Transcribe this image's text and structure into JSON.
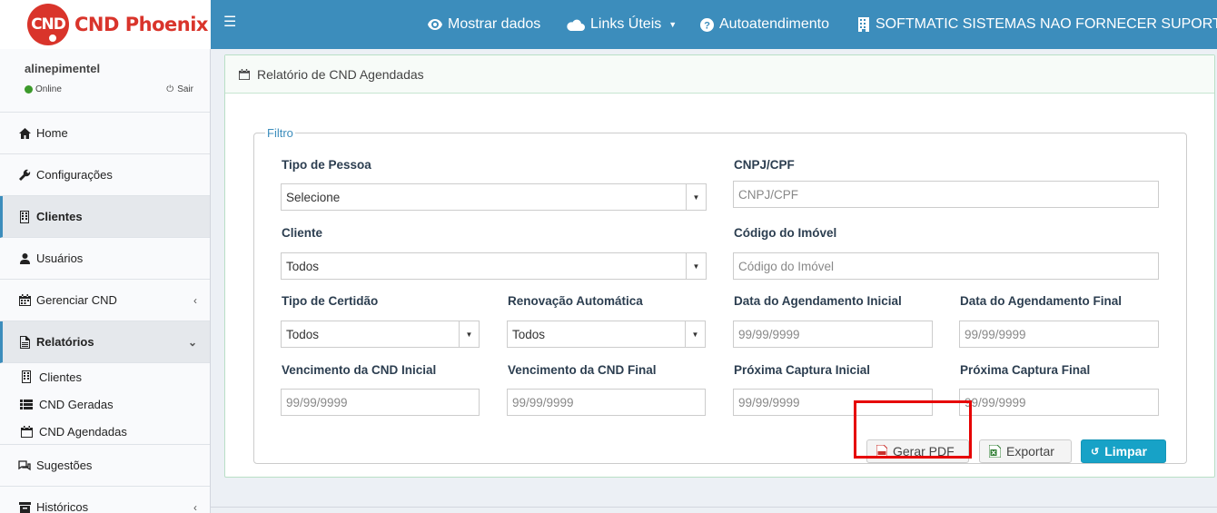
{
  "brand": {
    "badge": "CND",
    "name": "CND Phoenix",
    "color": "#d9342b"
  },
  "navbar": {
    "menu_icon": "hamburger-icon",
    "mostrar_dados": "Mostrar dados",
    "links_uteis": "Links Úteis",
    "autoatendimento": "Autoatendimento",
    "company": "SOFTMATIC SISTEMAS NAO FORNECER SUPORTE",
    "color": "#3c8dbc"
  },
  "user": {
    "name": "alinepimentel",
    "status": "Online",
    "logout": "Sair"
  },
  "sidebar": {
    "items": [
      {
        "label": "Home",
        "icon": "home-icon"
      },
      {
        "label": "Configurações",
        "icon": "wrench-icon"
      },
      {
        "label": "Clientes",
        "icon": "building-icon"
      },
      {
        "label": "Usuários",
        "icon": "user-icon"
      },
      {
        "label": "Gerenciar CND",
        "icon": "calendar-icon"
      },
      {
        "label": "Relatórios",
        "icon": "file-icon"
      },
      {
        "label": "Sugestões",
        "icon": "comments-icon"
      },
      {
        "label": "Históricos",
        "icon": "archive-icon"
      }
    ],
    "submenu": [
      {
        "label": "Clientes",
        "icon": "building-icon"
      },
      {
        "label": "CND Geradas",
        "icon": "list-icon"
      },
      {
        "label": "CND Agendadas",
        "icon": "calendar-icon"
      }
    ]
  },
  "page": {
    "title": "Relatório de CND Agendadas",
    "filter_legend": "Filtro",
    "fields": {
      "tipo_pessoa": {
        "label": "Tipo de Pessoa",
        "value": "Selecione"
      },
      "cnpj_cpf": {
        "label": "CNPJ/CPF",
        "placeholder": "CNPJ/CPF"
      },
      "cliente": {
        "label": "Cliente",
        "value": "Todos"
      },
      "codigo_imovel": {
        "label": "Código do Imóvel",
        "placeholder": "Código do Imóvel"
      },
      "tipo_certidao": {
        "label": "Tipo de Certidão",
        "value": "Todos"
      },
      "renovacao": {
        "label": "Renovação Automática",
        "value": "Todos"
      },
      "data_ag_ini": {
        "label": "Data do Agendamento Inicial",
        "placeholder": "99/99/9999"
      },
      "data_ag_fim": {
        "label": "Data do Agendamento Final",
        "placeholder": "99/99/9999"
      },
      "venc_ini": {
        "label": "Vencimento da CND Inicial",
        "placeholder": "99/99/9999"
      },
      "venc_fim": {
        "label": "Vencimento da CND Final",
        "placeholder": "99/99/9999"
      },
      "prox_ini": {
        "label": "Próxima Captura Inicial",
        "placeholder": "99/99/9999"
      },
      "prox_fim": {
        "label": "Próxima Captura Final",
        "placeholder": "99/99/9999"
      }
    },
    "buttons": {
      "pdf": "Gerar PDF",
      "exportar": "Exportar",
      "limpar": "Limpar"
    }
  }
}
